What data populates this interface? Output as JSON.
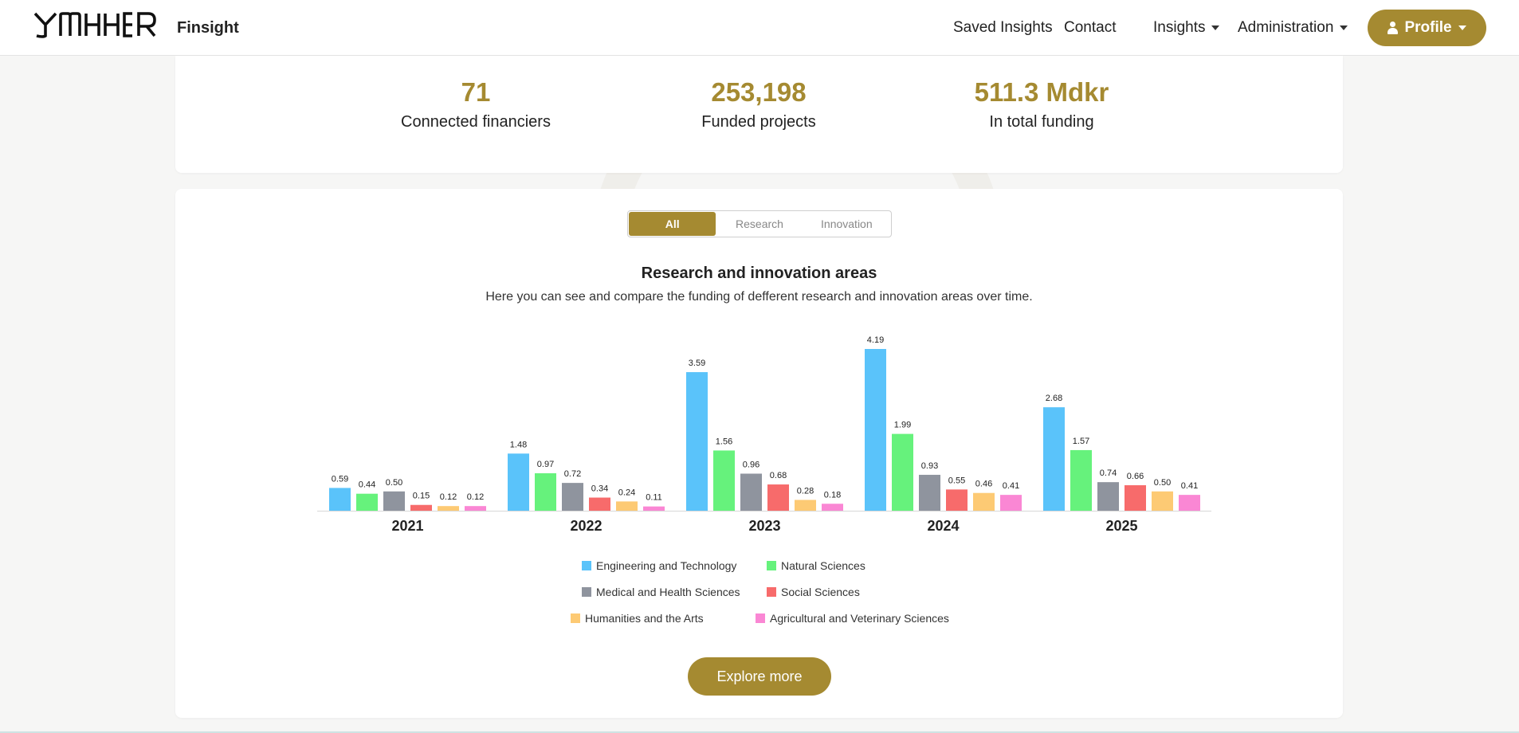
{
  "header": {
    "app_name": "Finsight",
    "nav": {
      "saved_insights": "Saved Insights",
      "contact": "Contact",
      "insights": "Insights",
      "administration": "Administration",
      "profile": "Profile"
    }
  },
  "stats": [
    {
      "value": "71",
      "label": "Connected financiers"
    },
    {
      "value": "253,198",
      "label": "Funded projects"
    },
    {
      "value": "511.3 Mdkr",
      "label": "In total funding"
    }
  ],
  "tabs": [
    {
      "label": "All",
      "active": true
    },
    {
      "label": "Research",
      "active": false
    },
    {
      "label": "Innovation",
      "active": false
    }
  ],
  "chart_section": {
    "title": "Research and innovation areas",
    "subtitle": "Here you can see and compare the funding of defferent research and innovation areas over time.",
    "explore_label": "Explore more"
  },
  "chart_data": {
    "type": "bar",
    "title": "Research and innovation areas",
    "categories": [
      "2021",
      "2022",
      "2023",
      "2024",
      "2025"
    ],
    "ylim": [
      0,
      4.19
    ],
    "grid": false,
    "legend_position": "bottom",
    "series": [
      {
        "name": "Engineering and Technology",
        "color": "#5ac3fa",
        "values": [
          0.59,
          1.48,
          3.59,
          4.19,
          2.68
        ],
        "labels": [
          "0.59",
          "1.48",
          "3.59",
          "4.19",
          "2.68"
        ]
      },
      {
        "name": "Natural Sciences",
        "color": "#66f27c",
        "values": [
          0.44,
          0.97,
          1.56,
          1.99,
          1.57
        ],
        "labels": [
          "0.44",
          "0.97",
          "1.56",
          "1.99",
          "1.57"
        ]
      },
      {
        "name": "Medical and Health Sciences",
        "color": "#8f949e",
        "values": [
          0.5,
          0.72,
          0.96,
          0.93,
          0.74
        ],
        "labels": [
          "0.50",
          "0.72",
          "0.96",
          "0.93",
          "0.74"
        ]
      },
      {
        "name": "Social Sciences",
        "color": "#f76b6b",
        "values": [
          0.15,
          0.34,
          0.68,
          0.55,
          0.66
        ],
        "labels": [
          "0.15",
          "0.34",
          "0.68",
          "0.55",
          "0.66"
        ]
      },
      {
        "name": "Humanities and the Arts",
        "color": "#fdca74",
        "values": [
          0.12,
          0.24,
          0.28,
          0.46,
          0.5
        ],
        "labels": [
          "0.12",
          "0.24",
          "0.28",
          "0.46",
          "0.50"
        ]
      },
      {
        "name": "Agricultural and Veterinary Sciences",
        "color": "#fa87d4",
        "values": [
          0.12,
          0.11,
          0.18,
          0.41,
          0.41
        ],
        "labels": [
          "0.12",
          "0.11",
          "0.18",
          "0.41",
          "0.41"
        ]
      }
    ]
  }
}
